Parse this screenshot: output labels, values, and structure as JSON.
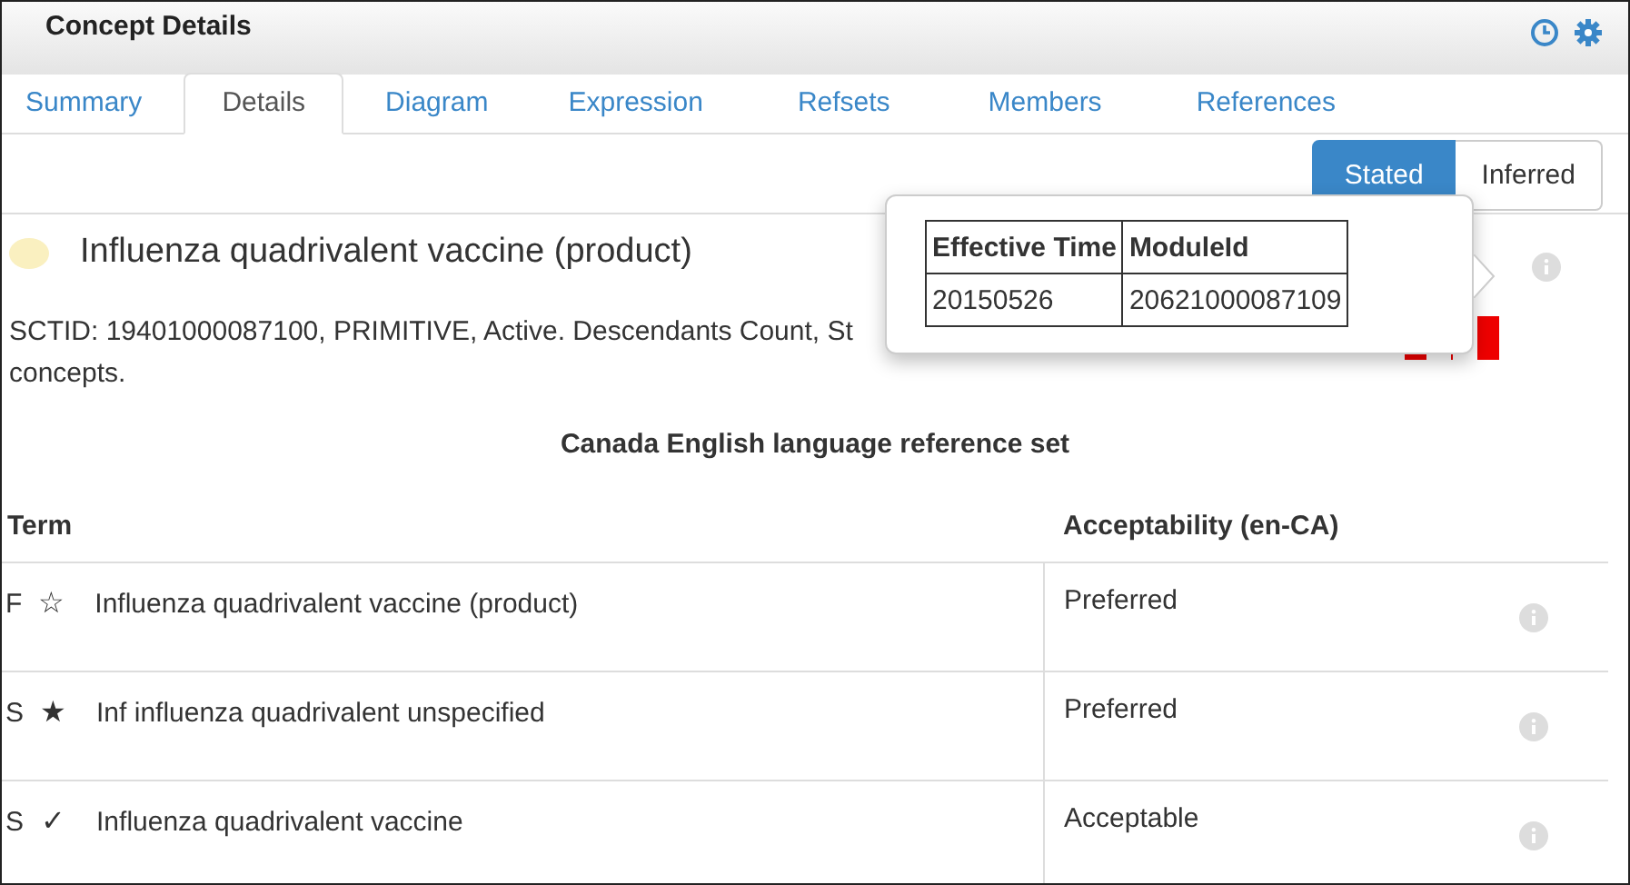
{
  "panel": {
    "title": "Concept Details"
  },
  "tabs": [
    {
      "label": "Summary",
      "selected": false
    },
    {
      "label": "Details",
      "selected": true
    },
    {
      "label": "Diagram",
      "selected": false
    },
    {
      "label": "Expression",
      "selected": false
    },
    {
      "label": "Refsets",
      "selected": false
    },
    {
      "label": "Members",
      "selected": false
    },
    {
      "label": "References",
      "selected": false
    }
  ],
  "view_toggle": [
    {
      "label": "Stated",
      "selected": true
    },
    {
      "label": "Inferred",
      "selected": false
    }
  ],
  "concept": {
    "name": "Influenza quadrivalent vaccine (product)",
    "description_lines": [
      "SCTID: 19401000087100, PRIMITIVE, Active. Descendants Count, St",
      "concepts."
    ]
  },
  "popover": {
    "columns": [
      "Effective Time",
      "ModuleId"
    ],
    "rows": [
      [
        "20150526",
        "20621000087109"
      ]
    ]
  },
  "refset": {
    "title": "Canada English language reference set",
    "columns": [
      "Term",
      "Acceptability  (en-CA)"
    ],
    "rows": [
      {
        "type": "F",
        "symbol": "☆",
        "term": "Influenza quadrivalent vaccine (product)",
        "acceptability": "Preferred"
      },
      {
        "type": "S",
        "symbol": "★",
        "term": "Inf influenza quadrivalent unspecified",
        "acceptability": "Preferred"
      },
      {
        "type": "S",
        "symbol": "✓",
        "term": "Influenza quadrivalent vaccine",
        "acceptability": "Acceptable"
      }
    ]
  }
}
